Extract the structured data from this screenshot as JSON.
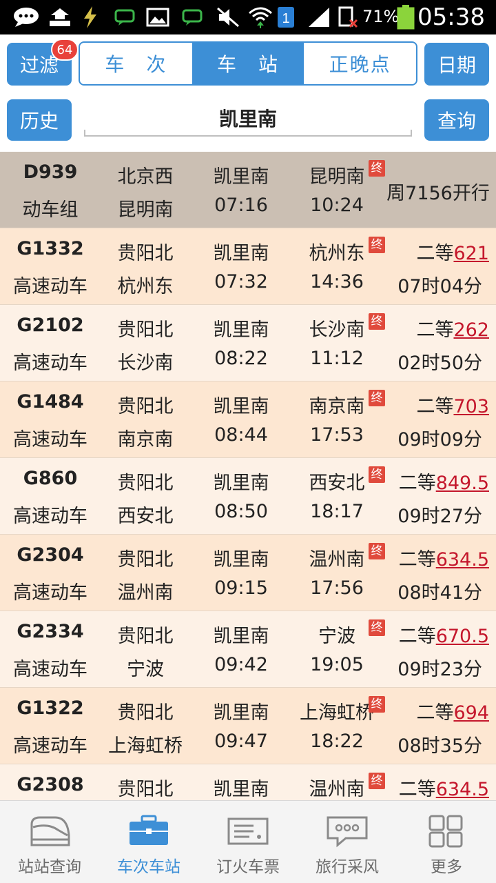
{
  "status_bar": {
    "battery_percent": "71%",
    "time": "05:38",
    "sim_label": "1",
    "icons": [
      "chat-bubble-icon",
      "upload-icon",
      "flash-icon",
      "message-icon",
      "image-icon",
      "message-icon",
      "mute-icon",
      "wifi-icon",
      "sim-icon",
      "signal-icon",
      "no-sim-icon",
      "battery-icon"
    ]
  },
  "header": {
    "filter_label": "过滤",
    "filter_badge": "64",
    "tabs": [
      {
        "label": "车　次",
        "active": false
      },
      {
        "label": "车　站",
        "active": true
      },
      {
        "label": "正晚点",
        "active": false
      }
    ],
    "date_label": "日期",
    "history_label": "历史",
    "station_value": "凯里南",
    "query_label": "查询"
  },
  "trains": [
    {
      "number": "D939",
      "type": "动车组",
      "origin": "北京西",
      "terminal": "昆明南",
      "station": "凯里南",
      "departs": "07:16",
      "destination": "昆明南",
      "arrives": "10:24",
      "terminal_badge": "终",
      "note": "周7156开行"
    },
    {
      "number": "G1332",
      "type": "高速动车",
      "origin": "贵阳北",
      "terminal": "杭州东",
      "station": "凯里南",
      "departs": "07:32",
      "destination": "杭州东",
      "arrives": "14:36",
      "terminal_badge": "终",
      "seat": "二等",
      "price": "621",
      "duration": "07时04分"
    },
    {
      "number": "G2102",
      "type": "高速动车",
      "origin": "贵阳北",
      "terminal": "长沙南",
      "station": "凯里南",
      "departs": "08:22",
      "destination": "长沙南",
      "arrives": "11:12",
      "terminal_badge": "终",
      "seat": "二等",
      "price": "262",
      "duration": "02时50分"
    },
    {
      "number": "G1484",
      "type": "高速动车",
      "origin": "贵阳北",
      "terminal": "南京南",
      "station": "凯里南",
      "departs": "08:44",
      "destination": "南京南",
      "arrives": "17:53",
      "terminal_badge": "终",
      "seat": "二等",
      "price": "703",
      "duration": "09时09分"
    },
    {
      "number": "G860",
      "type": "高速动车",
      "origin": "贵阳北",
      "terminal": "西安北",
      "station": "凯里南",
      "departs": "08:50",
      "destination": "西安北",
      "arrives": "18:17",
      "terminal_badge": "终",
      "seat": "二等",
      "price": "849.5",
      "duration": "09时27分"
    },
    {
      "number": "G2304",
      "type": "高速动车",
      "origin": "贵阳北",
      "terminal": "温州南",
      "station": "凯里南",
      "departs": "09:15",
      "destination": "温州南",
      "arrives": "17:56",
      "terminal_badge": "终",
      "seat": "二等",
      "price": "634.5",
      "duration": "08时41分"
    },
    {
      "number": "G2334",
      "type": "高速动车",
      "origin": "贵阳北",
      "terminal": "宁波",
      "station": "凯里南",
      "departs": "09:42",
      "destination": "宁波",
      "arrives": "19:05",
      "terminal_badge": "终",
      "seat": "二等",
      "price": "670.5",
      "duration": "09时23分"
    },
    {
      "number": "G1322",
      "type": "高速动车",
      "origin": "贵阳北",
      "terminal": "上海虹桥",
      "station": "凯里南",
      "departs": "09:47",
      "destination": "上海虹桥",
      "arrives": "18:22",
      "terminal_badge": "终",
      "seat": "二等",
      "price": "694",
      "duration": "08时35分"
    },
    {
      "number": "G2308",
      "type": "",
      "origin": "贵阳北",
      "terminal": "",
      "station": "凯里南",
      "departs": "",
      "destination": "温州南",
      "arrives": "",
      "terminal_badge": "终",
      "seat": "二等",
      "price": "634.5",
      "duration": ""
    }
  ],
  "bottom_nav": [
    {
      "label": "站站查询",
      "icon": "train-icon",
      "active": false
    },
    {
      "label": "车次车站",
      "icon": "briefcase-icon",
      "active": true
    },
    {
      "label": "订火车票",
      "icon": "ticket-icon",
      "active": false
    },
    {
      "label": "旅行采风",
      "icon": "chat-icon",
      "active": false
    },
    {
      "label": "更多",
      "icon": "grid-icon",
      "active": false
    }
  ],
  "colors": {
    "accent": "#3d8fd6",
    "price": "#c4172c",
    "badge": "#e8413a"
  }
}
